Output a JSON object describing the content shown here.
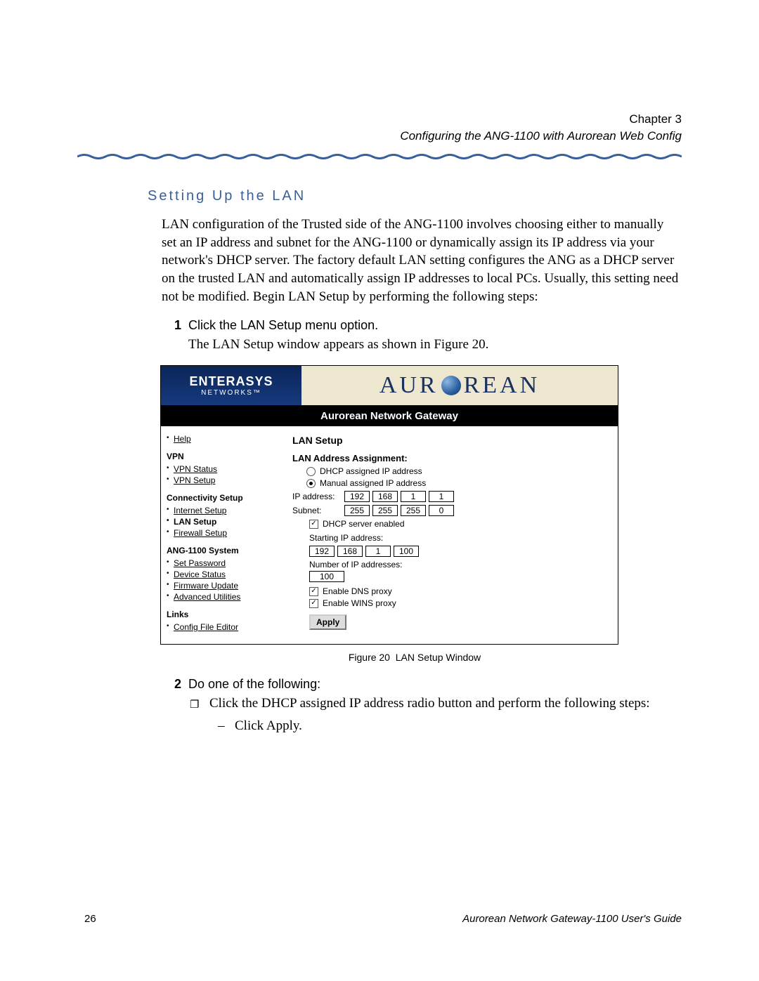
{
  "header": {
    "chapter": "Chapter 3",
    "subtitle": "Configuring the ANG-1100 with Aurorean Web Config"
  },
  "section": {
    "title": "Setting Up the LAN",
    "intro": "LAN configuration of the Trusted side of the ANG-1100 involves choosing either to manually set an IP address and subnet for the ANG-1100 or dynamically assign its IP address via your network's DHCP server. The factory default LAN setting configures the ANG as a DHCP server on the trusted LAN and automatically assign IP addresses to local PCs. Usually, this setting need not be modified. Begin LAN Setup by performing the following steps:"
  },
  "steps": {
    "s1_num": "1",
    "s1_text": "Click the LAN Setup menu option.",
    "s1_follow": "The LAN Setup window appears as shown in Figure 20.",
    "s2_num": "2",
    "s2_text": "Do one of the following:",
    "s2_sub1": "Click the DHCP assigned IP address radio button and perform the following steps:",
    "s2_sub1_dash1": "Click Apply."
  },
  "figure": {
    "banner_left_top": "ENTERASYS",
    "banner_left_bottom": "NETWORKS™",
    "banner_right_a": "AUR",
    "banner_right_b": "REAN",
    "title_bar": "Aurorean Network Gateway",
    "sidebar": {
      "help": "Help",
      "grp_vpn": "VPN",
      "vpn_status": "VPN Status",
      "vpn_setup": "VPN Setup",
      "grp_conn": "Connectivity Setup",
      "internet_setup": "Internet Setup",
      "lan_setup": "LAN Setup",
      "firewall_setup": "Firewall Setup",
      "grp_sys": "ANG-1100 System",
      "set_password": "Set Password",
      "device_status": "Device Status",
      "firmware_update": "Firmware Update",
      "advanced_utils": "Advanced Utilities",
      "grp_links": "Links",
      "config_editor": "Config File Editor"
    },
    "main": {
      "heading": "LAN Setup",
      "sect_label": "LAN Address Assignment:",
      "radio_dhcp": "DHCP assigned IP address",
      "radio_manual": "Manual assigned IP address",
      "ip_label": "IP address:",
      "subnet_label": "Subnet:",
      "ip": [
        "192",
        "168",
        "1",
        "1"
      ],
      "subnet": [
        "255",
        "255",
        "255",
        "0"
      ],
      "dhcp_server": "DHCP server enabled",
      "start_ip_label": "Starting IP address:",
      "start_ip": [
        "192",
        "168",
        "1",
        "100"
      ],
      "num_addr_label": "Number of IP addresses:",
      "num_addr": "100",
      "dns_proxy": "Enable DNS proxy",
      "wins_proxy": "Enable WINS proxy",
      "apply": "Apply"
    },
    "caption_prefix": "Figure 20",
    "caption_text": "LAN Setup Window"
  },
  "footer": {
    "page": "26",
    "guide": "Aurorean Network Gateway-1100 User's Guide"
  }
}
